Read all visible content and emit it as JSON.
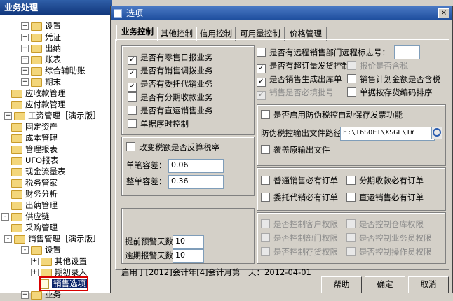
{
  "tree": {
    "header": "业务处理",
    "items": [
      {
        "label": "设置",
        "kind": "folder",
        "pm": "+"
      },
      {
        "label": "凭证",
        "kind": "folder",
        "pm": "+"
      },
      {
        "label": "出纳",
        "kind": "folder",
        "pm": "+"
      },
      {
        "label": "账表",
        "kind": "folder",
        "pm": "+"
      },
      {
        "label": "综合辅助账",
        "kind": "folder",
        "pm": "+"
      },
      {
        "label": "期末",
        "kind": "folder",
        "pm": "+"
      },
      {
        "label": "应收款管理",
        "kind": "folder",
        "pm": ""
      },
      {
        "label": "应付款管理",
        "kind": "folder",
        "pm": ""
      },
      {
        "label": "工资管理［演示版］",
        "kind": "folder",
        "pm": "+"
      },
      {
        "label": "固定资产",
        "kind": "folder",
        "pm": ""
      },
      {
        "label": "成本管理",
        "kind": "folder",
        "pm": ""
      },
      {
        "label": "管理报表",
        "kind": "folder",
        "pm": ""
      },
      {
        "label": "UFO报表",
        "kind": "folder",
        "pm": ""
      },
      {
        "label": "现金流量表",
        "kind": "folder",
        "pm": ""
      },
      {
        "label": "税务管家",
        "kind": "folder",
        "pm": ""
      },
      {
        "label": "财务分析",
        "kind": "folder",
        "pm": ""
      },
      {
        "label": "出纳管理",
        "kind": "folder",
        "pm": ""
      },
      {
        "label": "供应链",
        "kind": "folder",
        "pm": "-"
      },
      {
        "label": "采购管理",
        "kind": "folder",
        "pm": ""
      },
      {
        "label": "销售管理［演示版］",
        "kind": "folder",
        "pm": "-"
      },
      {
        "label": "设置",
        "kind": "folder",
        "pm": "-"
      },
      {
        "label": "其他设置",
        "kind": "folder",
        "pm": "+"
      },
      {
        "label": "期初录入",
        "kind": "folder",
        "pm": "+"
      },
      {
        "label": "销售选项",
        "kind": "doc",
        "pm": ""
      },
      {
        "label": "业务",
        "kind": "folder",
        "pm": "+"
      }
    ]
  },
  "dialog": {
    "title": "选项",
    "close": "×",
    "tabs": [
      "业务控制",
      "其他控制",
      "信用控制",
      "可用量控制",
      "价格管理"
    ],
    "left_checks": [
      {
        "label": "是否有零售日报业务",
        "checked": true
      },
      {
        "label": "是否有销售调拨业务",
        "checked": true
      },
      {
        "label": "是否有委托代销业务",
        "checked": true
      },
      {
        "label": "是否有分期收款业务",
        "checked": false
      },
      {
        "label": "是否有直运销售业务",
        "checked": false
      },
      {
        "label": "单据序时控制",
        "checked": false
      }
    ],
    "tax": {
      "check_label": "改变税额是否反算税率",
      "single_label": "单笔容差：",
      "single_value": "0.06",
      "whole_label": "整单容差：",
      "whole_value": "0.36"
    },
    "alerts": {
      "advance_label": "提前预警天数",
      "advance_value": "10",
      "overdue_label": "逾期报警天数",
      "overdue_value": "10"
    },
    "right_checks": {
      "remote_label": "是否有远程销售部门",
      "remote_flag_label": "远程标志号：",
      "remote_flag_value": "",
      "over_order": "是否有超订量发货控制",
      "price_tax": "报价是否含税",
      "gen_outbound": "是否销售生成出库单",
      "plan_tax": "销售计划金额是否含税",
      "batch_required": "销售是否必填批号",
      "sort_inventory": "单据按存货编码排序"
    },
    "invoice": {
      "check_label": "是否启用防伪税控自动保存发票功能",
      "path_label": "防伪税控输出文件路径",
      "path_value": "E:\\T6SOFT\\XSGL\\Im",
      "overwrite_label": "覆盖原输出文件"
    },
    "orders": {
      "normal": "普通销售必有订单",
      "installment": "分期收款必有订单",
      "consign": "委托代销必有订单",
      "direct": "直运销售必有订单"
    },
    "perms": {
      "customer": "是否控制客户权限",
      "warehouse": "是否控制仓库权限",
      "dept": "是否控制部门权限",
      "salesman": "是否控制业务员权限",
      "inventory": "是否控制存货权限",
      "operator": "是否控制操作员权限"
    },
    "status": "启用于[2012]会计年[4]会计月第一天：2012-04-01",
    "buttons": {
      "help": "帮助",
      "ok": "确定",
      "cancel": "取消"
    }
  }
}
